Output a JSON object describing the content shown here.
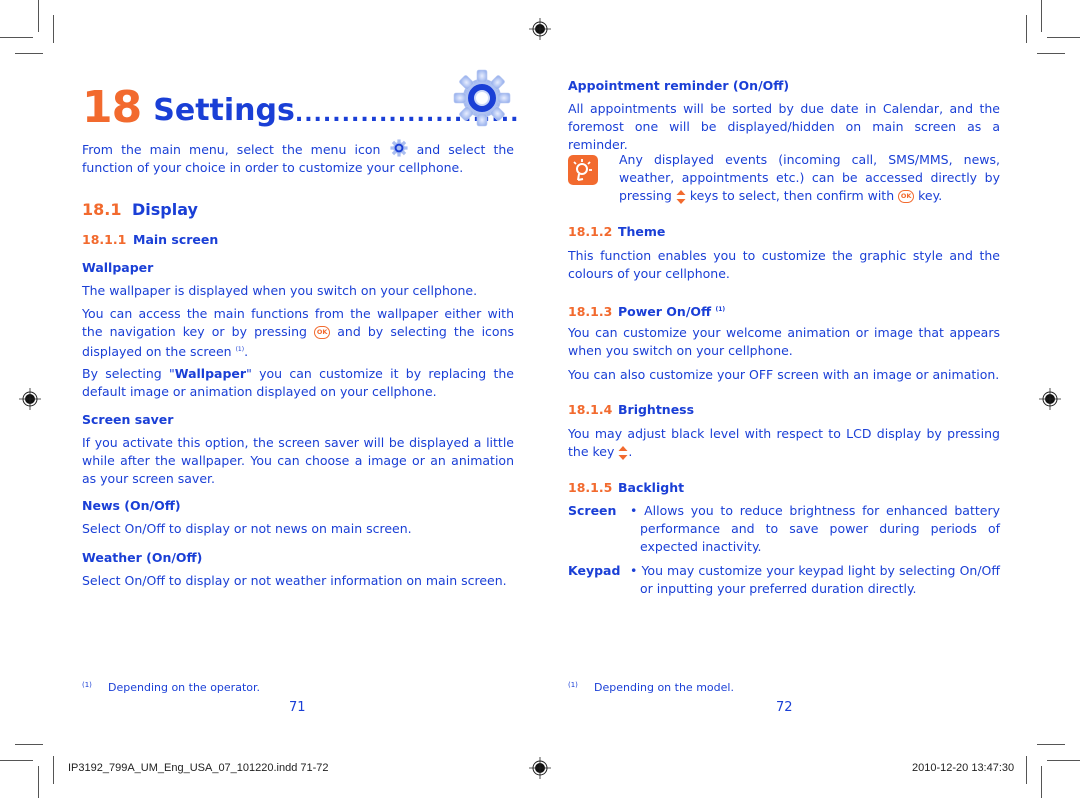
{
  "chapter": {
    "number": "18",
    "title": "Settings",
    "dots": "........................",
    "icon": "settings-gear-icon"
  },
  "left_page": {
    "intro": {
      "before_icon": "From the main menu, select the menu icon",
      "after_icon": "and select the function of your choice in order to customize your cellphone."
    },
    "section_18_1": {
      "number": "18.1",
      "title": "Display"
    },
    "section_18_1_1": {
      "number": "18.1.1",
      "title": "Main screen"
    },
    "wallpaper": {
      "heading": "Wallpaper",
      "p1": "The wallpaper is displayed when you switch on your cellphone.",
      "p2_before": "You can access the main functions from the wallpaper either with the navigation key or by pressing",
      "p2_after": "and by selecting the icons displayed on the screen",
      "p2_ref": "(1)",
      "p2_end": ".",
      "p3_before": "By selecting \"",
      "p3_bold": "Wallpaper",
      "p3_after": "\" you can customize it by replacing the default image or animation displayed on your cellphone."
    },
    "screen_saver": {
      "heading": "Screen saver",
      "text": "If you activate this option, the screen saver will be displayed a little while after the wallpaper. You can choose a image or an animation as your screen saver."
    },
    "news": {
      "heading": "News (On/Off)",
      "text": "Select On/Off to display or not news on main screen."
    },
    "weather": {
      "heading": "Weather (On/Off)",
      "text": "Select On/Off to display or not weather information on main screen."
    },
    "footnote": {
      "ref": "(1)",
      "text": "Depending on the operator."
    },
    "page_number": "71"
  },
  "right_page": {
    "appointment": {
      "heading": "Appointment reminder (On/Off)",
      "text": "All appointments will be sorted by due date in Calendar, and the foremost one will be displayed/hidden on main screen as a reminder."
    },
    "tip": {
      "icon": "lightbulb-tip-icon",
      "before_keys": "Any displayed events (incoming call, SMS/MMS, news, weather, appointments  etc.) can be accessed directly by pressing",
      "after_keys": "keys to select, then confirm with",
      "end": "key."
    },
    "theme": {
      "number": "18.1.2",
      "title": "Theme",
      "text": "This function enables you to customize the graphic style and the colours of your cellphone."
    },
    "power": {
      "number": "18.1.3",
      "title": "Power On/Off",
      "ref": "(1)",
      "p1": "You can customize your welcome animation or image that appears when you switch on your cellphone.",
      "p2": "You can also customize your OFF screen with an image or animation."
    },
    "brightness": {
      "number": "18.1.4",
      "title": "Brightness",
      "text_before": "You may adjust black level with respect to LCD display by pressing the key",
      "text_end": "."
    },
    "backlight": {
      "number": "18.1.5",
      "title": "Backlight",
      "items": [
        {
          "label": "Screen",
          "text": "• Allows you to reduce brightness for enhanced battery performance and to save power during periods of expected inactivity."
        },
        {
          "label": "Keypad",
          "text": "• You may customize your keypad light by selecting On/Off or inputting your preferred duration directly."
        }
      ]
    },
    "footnote": {
      "ref": "(1)",
      "text": "Depending on the model."
    },
    "page_number": "72"
  },
  "ok_key_label": "OK",
  "slug": {
    "file": "IP3192_799A_UM_Eng_USA_07_101220.indd   71-72",
    "timestamp": "2010-12-20   13:47:30"
  }
}
